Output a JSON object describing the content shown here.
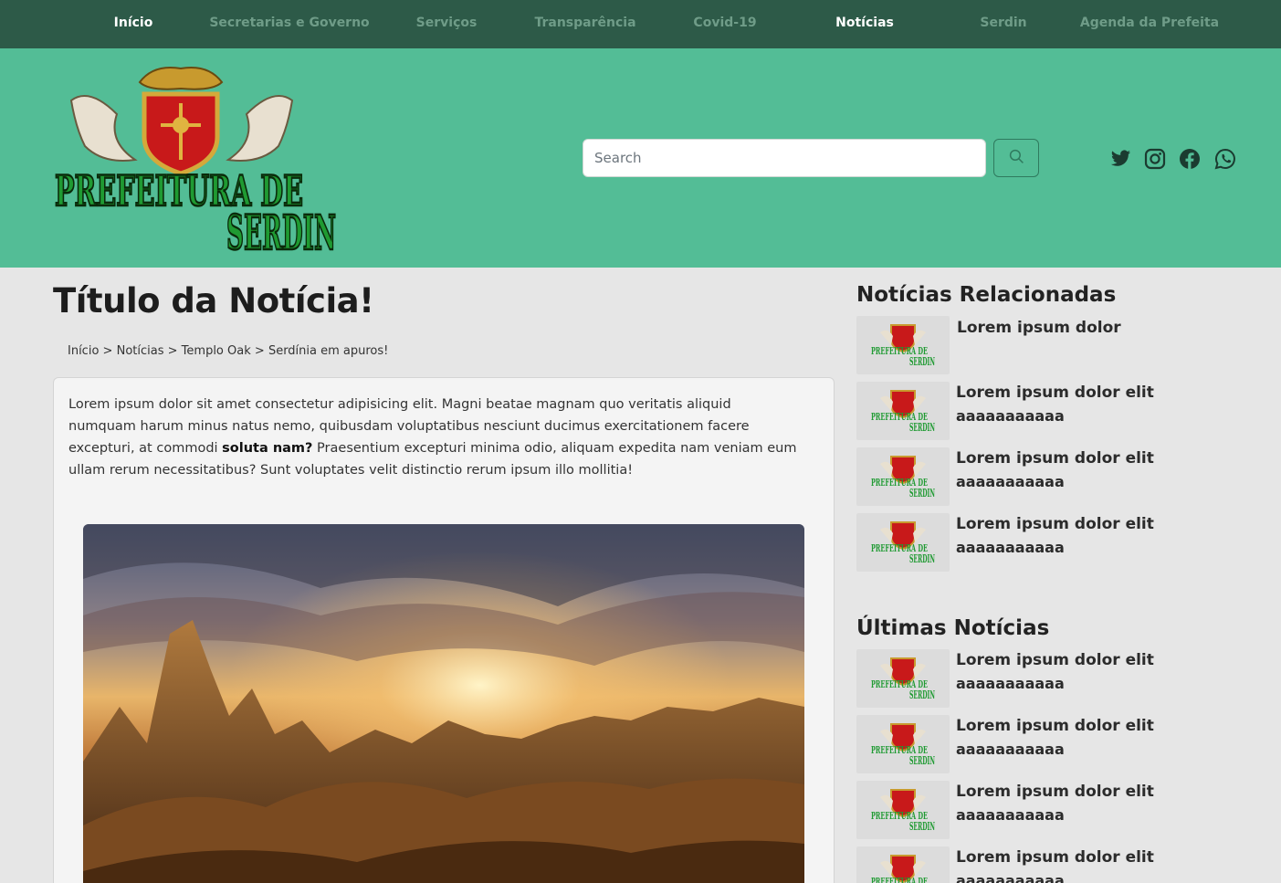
{
  "nav": {
    "items": [
      "Início",
      "Secretarias e Governo",
      "Serviços",
      "Transparência",
      "Covid-19",
      "Notícias",
      "Serdin",
      "Agenda da Prefeita"
    ]
  },
  "header": {
    "logo_text_line1": "PREFEITURA DE",
    "logo_text_line2": "SERDIN",
    "search_placeholder": "Search",
    "social_icons": [
      "twitter-icon",
      "instagram-icon",
      "facebook-icon",
      "whatsapp-icon"
    ]
  },
  "article": {
    "title": "Título da Notícia!",
    "breadcrumb": [
      "Início",
      "Notícias",
      "Templo Oak",
      "Serdínia em apuros!"
    ],
    "breadcrumb_sep": ">",
    "body_before": "Lorem ipsum dolor sit amet consectetur adipisicing elit. Magni beatae magnam quo veritatis aliquid numquam harum minus natus nemo, quibusdam voluptatibus nesciunt ducimus exercitationem facere excepturi, at commodi ",
    "body_bold": "soluta nam?",
    "body_after": " Praesentium excepturi minima odio, aliquam expedita nam veniam eum ullam rerum necessitatibus? Sunt voluptates velit distinctio rerum ipsum illo mollitia!"
  },
  "related": {
    "heading": "Notícias Relacionadas",
    "items": [
      {
        "title": "Lorem ipsum dolor",
        "subtitle": ""
      },
      {
        "title": "Lorem ipsum dolor elit",
        "subtitle": "aaaaaaaaaaa"
      },
      {
        "title": "Lorem ipsum dolor elit",
        "subtitle": "aaaaaaaaaaa"
      },
      {
        "title": "Lorem ipsum dolor elit",
        "subtitle": "aaaaaaaaaaa"
      }
    ]
  },
  "latest": {
    "heading": "Últimas Notícias",
    "items": [
      {
        "title": "Lorem ipsum dolor elit",
        "subtitle": "aaaaaaaaaaa"
      },
      {
        "title": "Lorem ipsum dolor elit",
        "subtitle": "aaaaaaaaaaa"
      },
      {
        "title": "Lorem ipsum dolor elit",
        "subtitle": "aaaaaaaaaaa"
      },
      {
        "title": "Lorem ipsum dolor elit",
        "subtitle": "aaaaaaaaaaa"
      }
    ]
  },
  "colors": {
    "nav_bg": "#2d5a48",
    "header_bg": "#53bd96",
    "page_bg": "#e6e6e6",
    "nav_active": "#ffffff",
    "nav_inactive": "#6f9c88"
  }
}
